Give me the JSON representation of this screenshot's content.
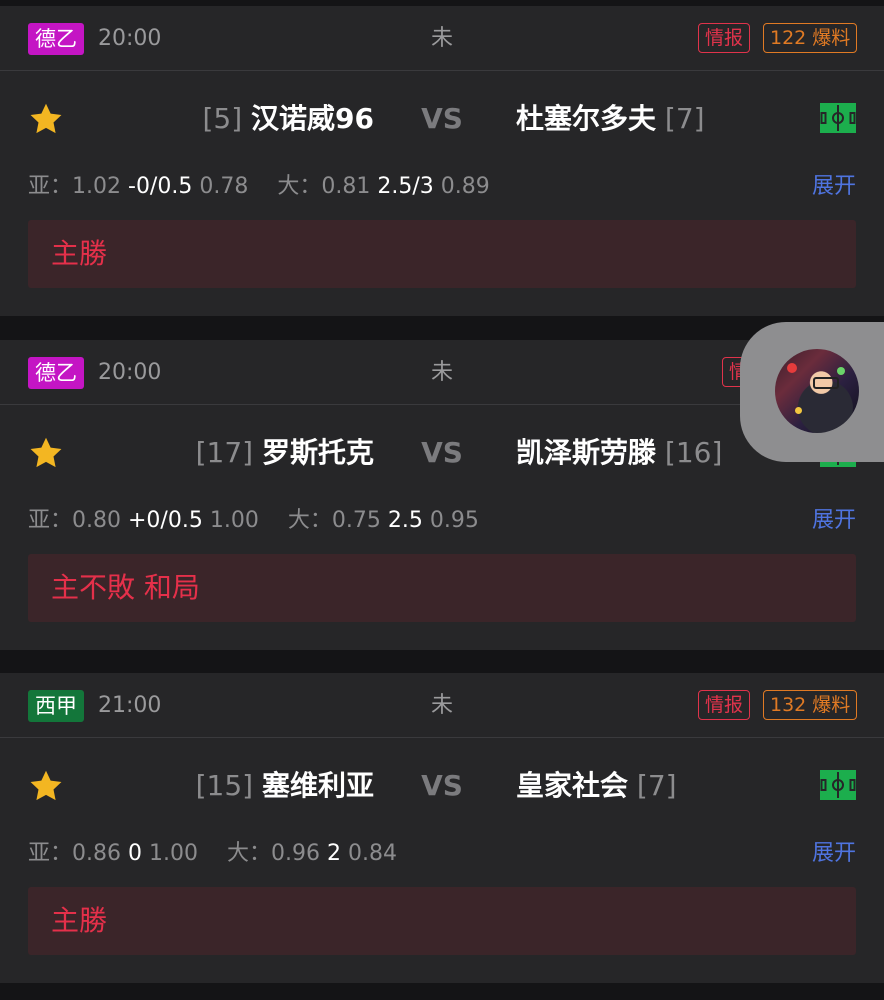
{
  "colors": {
    "league_de2": "#c415c4",
    "league_laliga": "#13763a",
    "info_tag": "#e0334b",
    "burst_tag": "#e07a24",
    "expand_link": "#4f74e0",
    "pick_text": "#e5304a",
    "star": "#f3b622",
    "field_icon": "#1cae4d"
  },
  "matches": [
    {
      "league": "德乙",
      "time": "20:00",
      "status": "未",
      "info_tag": "情报",
      "burst_tag": "122 爆料",
      "home_rank": "[5]",
      "home_team": "汉诺威96",
      "vs": "VS",
      "away_team": "杜塞尔多夫",
      "away_rank": "[7]",
      "asia_label": "亚：",
      "asia_home": "1.02",
      "asia_line": "-0/0.5",
      "asia_away": "0.78",
      "ou_label": "大：",
      "ou_over": "0.81",
      "ou_line": "2.5/3",
      "ou_under": "0.89",
      "expand": "展开",
      "pick": "主勝"
    },
    {
      "league": "德乙",
      "time": "20:00",
      "status": "未",
      "info_tag": "情",
      "burst_tag": "",
      "home_rank": "[17]",
      "home_team": "罗斯托克",
      "vs": "VS",
      "away_team": "凯泽斯劳滕",
      "away_rank": "[16]",
      "asia_label": "亚：",
      "asia_home": "0.80",
      "asia_line": "+0/0.5",
      "asia_away": "1.00",
      "ou_label": "大：",
      "ou_over": "0.75",
      "ou_line": "2.5",
      "ou_under": "0.95",
      "expand": "展开",
      "pick": "主不敗 和局"
    },
    {
      "league": "西甲",
      "time": "21:00",
      "status": "未",
      "info_tag": "情报",
      "burst_tag": "132 爆料",
      "home_rank": "[15]",
      "home_team": "塞维利亚",
      "vs": "VS",
      "away_team": "皇家社会",
      "away_rank": "[7]",
      "asia_label": "亚：",
      "asia_home": "0.86",
      "asia_line": "0",
      "asia_away": "1.00",
      "ou_label": "大：",
      "ou_over": "0.96",
      "ou_line": "2",
      "ou_under": "0.84",
      "expand": "展开",
      "pick": "主勝"
    }
  ]
}
